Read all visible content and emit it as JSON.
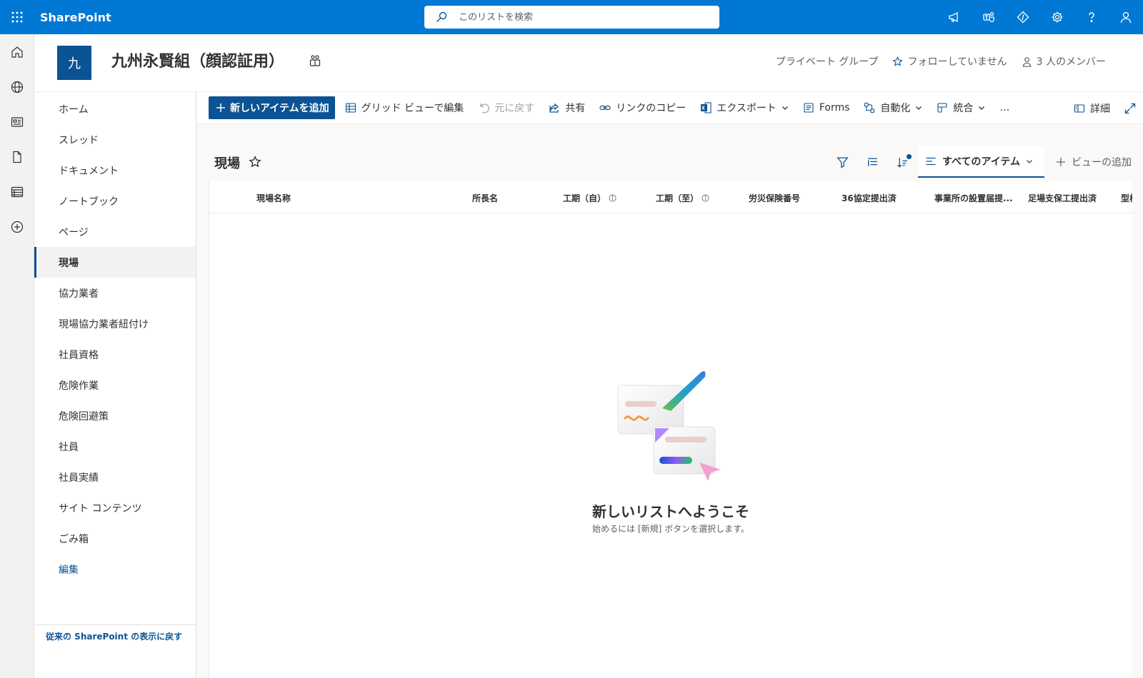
{
  "suite": {
    "app_name": "SharePoint",
    "search_placeholder": "このリストを検索"
  },
  "site": {
    "logo_letter": "九",
    "title": "九州永賢組（顔認証用）",
    "privacy": "プライベート グループ",
    "follow": "フォローしていません",
    "members": "3 人のメンバー"
  },
  "nav": {
    "items": [
      {
        "label": "ホーム"
      },
      {
        "label": "スレッド"
      },
      {
        "label": "ドキュメント"
      },
      {
        "label": "ノートブック"
      },
      {
        "label": "ページ"
      },
      {
        "label": "現場"
      },
      {
        "label": "協力業者"
      },
      {
        "label": "現場協力業者紐付け"
      },
      {
        "label": "社員資格"
      },
      {
        "label": "危険作業"
      },
      {
        "label": "危険回避策"
      },
      {
        "label": "社員"
      },
      {
        "label": "社員実績"
      },
      {
        "label": "サイト コンテンツ"
      },
      {
        "label": "ごみ箱"
      },
      {
        "label": "編集"
      }
    ],
    "selected": "現場",
    "classic_link": "従来の SharePoint の表示に戻す"
  },
  "commandbar": {
    "new_item": "新しいアイテムを追加",
    "grid_edit": "グリッド ビューで編集",
    "undo": "元に戻す",
    "share": "共有",
    "copy_link": "リンクのコピー",
    "export": "エクスポート",
    "forms": "Forms",
    "automate": "自動化",
    "integrate": "統合",
    "more": "…",
    "details": "詳細"
  },
  "list": {
    "title": "現場",
    "view_name": "すべてのアイテム",
    "add_view": "ビューの追加",
    "columns": [
      "現場名称",
      "所長名",
      "工期（自）",
      "工期（至）",
      "労災保険番号",
      "36協定提出済",
      "事業所の設置届提...",
      "足場支保工提出済",
      "型枠"
    ],
    "empty_title": "新しいリストへようこそ",
    "empty_sub": "始めるには [新規] ボタンを選択します。"
  }
}
